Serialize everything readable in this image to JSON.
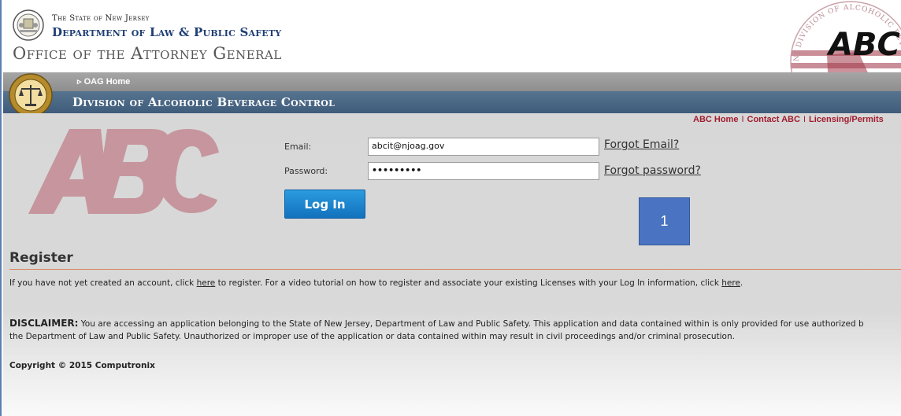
{
  "header": {
    "state": "The State of New Jersey",
    "department": "Department of Law & Public Safety",
    "office": "Office of the Attorney General",
    "logo_text": "ABC",
    "logo_ring_text": "NJ DIVISION OF ALCOHOLIC BEVERAGE CONTROL"
  },
  "nav": {
    "oag_home": "OAG Home",
    "division_title": "Division of Alcoholic Beverage Control"
  },
  "top_links": [
    {
      "label": "ABC Home"
    },
    {
      "label": "Contact ABC"
    },
    {
      "label": "Licensing/Permits"
    }
  ],
  "top_links_separator": "I",
  "login": {
    "email_label": "Email:",
    "email_value": "abcit@njoag.gov",
    "password_label": "Password:",
    "password_value": "•••••••••",
    "forgot_email": "Forgot Email?",
    "forgot_password": "Forgot password?",
    "login_button": "Log In"
  },
  "marker": {
    "label": "1"
  },
  "register": {
    "heading": "Register",
    "line1_a": "If you have not yet created an account, click ",
    "line1_link1": "here",
    "line1_b": " to register. For a video tutorial on how to register and associate your existing Licenses with your Log In information, click ",
    "line1_link2": "here",
    "line1_c": ".",
    "disclaimer_label": "DISCLAIMER:",
    "disclaimer_line1": " You are accessing an application belonging to the State of New Jersey, Department of Law and Public Safety. This application and data contained within is only provided for use authorized b",
    "disclaimer_line2": "the Department of Law and Public Safety. Unauthorized or improper use of the application or data contained within may result in civil proceedings and/or criminal prosecution.",
    "copyright": "Copyright © 2015 Computronix"
  },
  "colors": {
    "nav_blue": "#3f5c7b",
    "link_red": "#a01c2e",
    "button_blue": "#1a7fcc",
    "abc_red": "#a3384a"
  }
}
